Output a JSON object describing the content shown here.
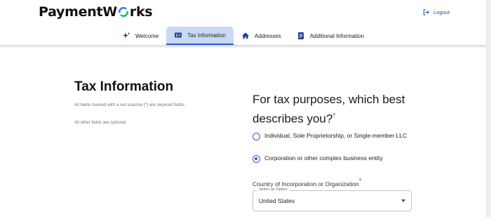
{
  "header": {
    "logo_text_before": "PaymentW",
    "logo_text_after": "rks",
    "logout_label": "Logout"
  },
  "tabs": [
    {
      "label": "Welcome",
      "icon": "sparkle-icon",
      "active": false
    },
    {
      "label": "Tax Information",
      "icon": "id-card-icon",
      "active": true
    },
    {
      "label": "Addresses",
      "icon": "home-icon",
      "active": false
    },
    {
      "label": "Additional Information",
      "icon": "document-icon",
      "active": false
    }
  ],
  "main": {
    "title": "Tax Information",
    "note_required_before": "All fields marked with a red asterisk (",
    "note_required_star": "*",
    "note_required_after": ") are required fields.",
    "note_optional": "All other fields are optional.",
    "question": "For tax purposes, which best describes you?",
    "required_mark": "*",
    "options": [
      {
        "label": "Individual, Sole Proprietorship, or Single-member LLC",
        "selected": false
      },
      {
        "label": "Corporation or other complex business entity",
        "selected": true
      }
    ],
    "country_label": "Country of Incorporation or Organization",
    "country_select": {
      "legend": "Select an Option",
      "value": "United States"
    }
  },
  "colors": {
    "accent": "#2a5bd7",
    "active_tab_bg": "#c9d9f3",
    "required": "#d32f2f"
  }
}
